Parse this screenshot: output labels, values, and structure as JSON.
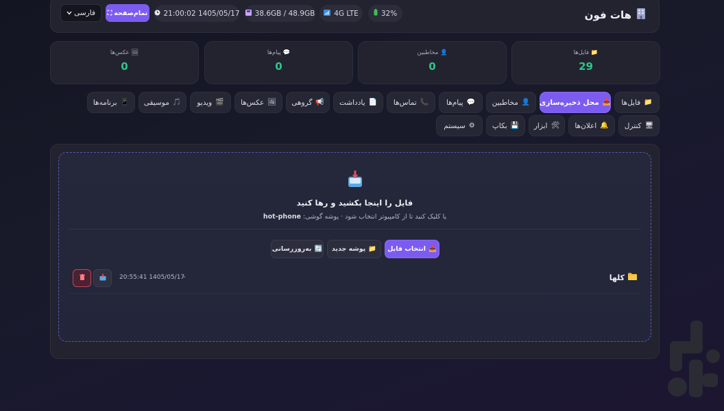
{
  "header": {
    "title": "هات فون",
    "title_icon": "building-icon",
    "battery": "32%",
    "network": "4G LTE",
    "storage": "38.6GB / 48.9GB",
    "datetime": "21:00:02 1405/05/17",
    "fullscreen_label": "تمام‌صفحه",
    "language": "فارسی"
  },
  "stats": [
    {
      "label": "فایل‌ها",
      "value": "29",
      "icon": "folder-icon"
    },
    {
      "label": "مخاطبین",
      "value": "0",
      "icon": "person-icon"
    },
    {
      "label": "پیام‌ها",
      "value": "0",
      "icon": "chat-icon"
    },
    {
      "label": "عکس‌ها",
      "value": "0",
      "icon": "image-icon"
    }
  ],
  "tabs_row1": [
    {
      "label": "فایل‌ها",
      "icon": "📁"
    },
    {
      "label": "محل ذخیره‌سازی",
      "icon": "📥",
      "active": true
    },
    {
      "label": "مخاطبین",
      "icon": "👤"
    },
    {
      "label": "پیام‌ها",
      "icon": "💬"
    },
    {
      "label": "تماس‌ها",
      "icon": "📞"
    },
    {
      "label": "یادداشت",
      "icon": "📄"
    },
    {
      "label": "گروهی",
      "icon": "📢"
    },
    {
      "label": "عکس‌ها",
      "icon": "🖼"
    },
    {
      "label": "ویدیو",
      "icon": "🎬"
    },
    {
      "label": "موسیقی",
      "icon": "🎵"
    },
    {
      "label": "برنامه‌ها",
      "icon": "📱"
    }
  ],
  "tabs_row2": [
    {
      "label": "کنترل",
      "icon": "🖥"
    },
    {
      "label": "اعلان‌ها",
      "icon": "🔔"
    },
    {
      "label": "ابزار",
      "icon": "🛠"
    },
    {
      "label": "بکاپ",
      "icon": "💾"
    },
    {
      "label": "سیستم",
      "icon": "⚙"
    }
  ],
  "dropzone": {
    "title": "فایل را اینجا بکشید و رها کنید",
    "subtitle": "یا کلیک کنید تا از کامپیوتر انتخاب شود · پوشه گوشی:",
    "folder": "hot-phone"
  },
  "actions": {
    "select_file": "انتخاب فایل",
    "new_folder": "پوشه جدید",
    "refresh": "به‌روزرسانی"
  },
  "files": [
    {
      "name": "کلها",
      "dash": "-",
      "date": "20:55:41 1405/05/17"
    }
  ],
  "colors": {
    "accent": "#7c5cf0",
    "value_green": "#2cc78a",
    "background": "#171827",
    "card": "#22232f",
    "danger": "#c64460"
  }
}
